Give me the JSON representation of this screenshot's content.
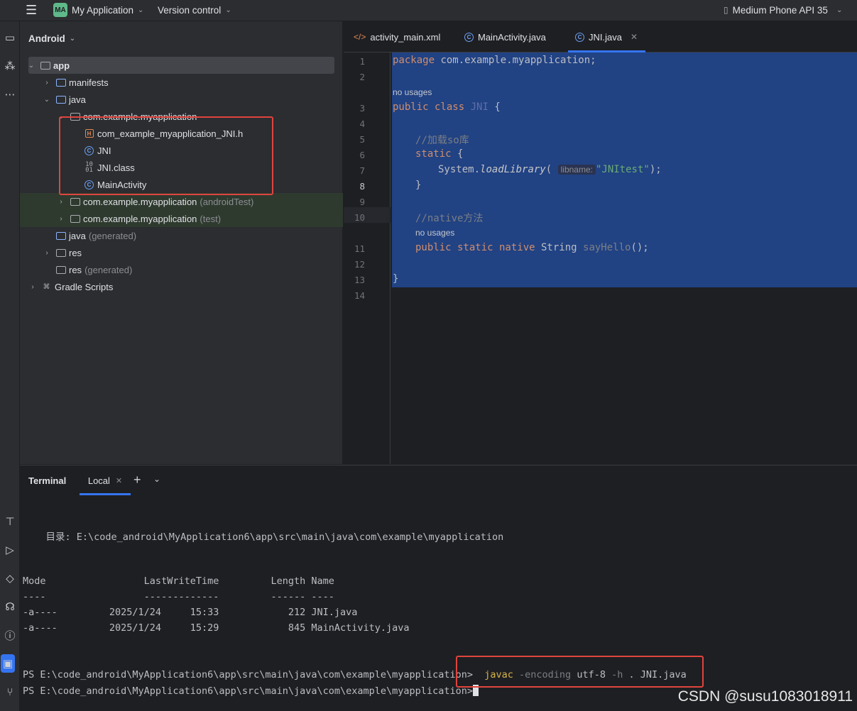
{
  "titlebar": {
    "project_initials": "MA",
    "project_name": "My Application",
    "version_control": "Version control",
    "device": "Medium Phone API 35"
  },
  "project_panel": {
    "view_mode": "Android",
    "tree": [
      {
        "label": "app",
        "suffix": ""
      },
      {
        "label": "manifests",
        "suffix": ""
      },
      {
        "label": "java",
        "suffix": ""
      },
      {
        "label": "com.example.myapplication",
        "suffix": ""
      },
      {
        "label": "com_example_myapplication_JNI.h",
        "suffix": ""
      },
      {
        "label": "JNI",
        "suffix": ""
      },
      {
        "label": "JNI.class",
        "suffix": ""
      },
      {
        "label": "MainActivity",
        "suffix": ""
      },
      {
        "label": "com.example.myapplication",
        "suffix": "(androidTest)"
      },
      {
        "label": "com.example.myapplication",
        "suffix": "(test)"
      },
      {
        "label": "java",
        "suffix": "(generated)"
      },
      {
        "label": "res",
        "suffix": ""
      },
      {
        "label": "res",
        "suffix": "(generated)"
      },
      {
        "label": "Gradle Scripts",
        "suffix": ""
      }
    ]
  },
  "editor": {
    "tabs": [
      {
        "label": "activity_main.xml"
      },
      {
        "label": "MainActivity.java"
      },
      {
        "label": "JNI.java"
      }
    ],
    "line_numbers": [
      "1",
      "2",
      "3",
      "4",
      "5",
      "6",
      "7",
      "8",
      "9",
      "10",
      "11",
      "12",
      "13",
      "14"
    ],
    "current_line": "8",
    "no_usages": "no usages",
    "code": {
      "l1_kw": "package",
      "l1_rest": " com.example.myapplication;",
      "l3_kw": "public class",
      "l3_cls": "JNI",
      "l3_rest": " {",
      "l5_cmt": "//加载so库",
      "l6_kw": "static",
      "l6_rest": " {",
      "l7_pre": "System.",
      "l7_mth": "loadLibrary",
      "l7_paren": "(",
      "l7_hint": "libname:",
      "l7_str": "\"JNItest\"",
      "l7_end": ");",
      "l8": "}",
      "l10_cmt": "//native方法",
      "l11_kw": "public static native",
      "l11_type": " String ",
      "l11_mth": "sayHello",
      "l11_end": "();",
      "l13": "}"
    }
  },
  "terminal": {
    "title": "Terminal",
    "tab_label": "Local",
    "dir_line": "    目录: E:\\code_android\\MyApplication6\\app\\src\\main\\java\\com\\example\\myapplication",
    "header": "Mode                 LastWriteTime         Length Name",
    "separator": "----                 -------------         ------ ----",
    "rows": [
      "-a----         2025/1/24     15:33            212 JNI.java",
      "-a----         2025/1/24     15:29            845 MainActivity.java"
    ],
    "prompt": "PS E:\\code_android\\MyApplication6\\app\\src\\main\\java\\com\\example\\myapplication>",
    "cmd_javac": "javac",
    "cmd_flag1": "-encoding",
    "cmd_val1": "utf-8",
    "cmd_flag2": "-h",
    "cmd_rest": ". JNI.java"
  },
  "watermark": "CSDN @susu1083018911",
  "icons": [
    "hamburger-icon",
    "folder-icon",
    "class-icon",
    "header-file-icon",
    "binary-file-icon",
    "terminal-icon",
    "run-icon",
    "phone-icon"
  ]
}
